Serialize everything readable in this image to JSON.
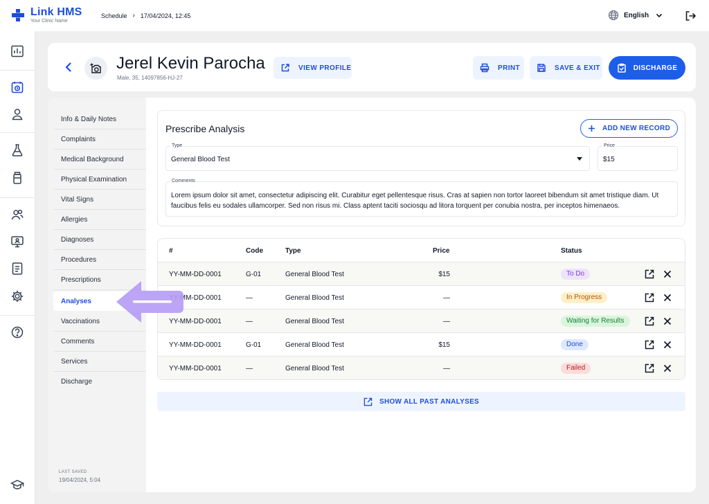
{
  "app": {
    "title": "Link HMS",
    "subtitle": "Your Clinic Name"
  },
  "breadcrumb": {
    "section": "Schedule",
    "separator": "›",
    "datetime": "17/04/2024, 12:45"
  },
  "language": "English",
  "patient": {
    "name": "Jerel Kevin Parocha",
    "meta": "Male, 35, 14097856-HJ-27"
  },
  "header_buttons": {
    "view_profile": "VIEW PROFILE",
    "print": "PRINT",
    "save_exit": "SAVE & EXIT",
    "discharge": "DISCHARGE"
  },
  "sidebar": {
    "items": [
      {
        "label": "Info & Daily Notes"
      },
      {
        "label": "Complaints"
      },
      {
        "label": "Medical Background"
      },
      {
        "label": "Physical Examination"
      },
      {
        "label": "Vital Signs"
      },
      {
        "label": "Allergies"
      },
      {
        "label": "Diagnoses"
      },
      {
        "label": "Procedures"
      },
      {
        "label": "Prescriptions"
      },
      {
        "label": "Analyses"
      },
      {
        "label": "Vaccinations"
      },
      {
        "label": "Comments"
      },
      {
        "label": "Services"
      },
      {
        "label": "Discharge"
      }
    ],
    "active": "Analyses",
    "last_saved_label": "LAST SAVED",
    "last_saved_value": "19/04/2024, 5:04"
  },
  "prescribe": {
    "title": "Prescribe Analysis",
    "add_button": "ADD NEW RECORD",
    "type_label": "Type",
    "type_value": "General Blood Test",
    "price_label": "Price",
    "price_value": "$15",
    "comments_label": "Comments",
    "comments_value": "Lorem ipsum dolor sit amet, consectetur adipiscing elit. Curabitur eget pellentesque risus. Cras at sapien non tortor laoreet bibendum sit amet tristique diam. Ut faucibus felis eu sodales ullamcorper. Sed non risus mi. Class aptent taciti sociosqu ad litora torquent per conubia nostra, per inceptos himenaeos."
  },
  "table": {
    "columns": {
      "id": "#",
      "code": "Code",
      "type": "Type",
      "price": "Price",
      "status": "Status"
    },
    "rows": [
      {
        "id": "YY-MM-DD-0001",
        "code": "G-01",
        "type": "General Blood Test",
        "price": "$15",
        "status": "To Do"
      },
      {
        "id": "YY-MM-DD-0001",
        "code": "—",
        "type": "General Blood Test",
        "price": "—",
        "status": "In Progress"
      },
      {
        "id": "YY-MM-DD-0001",
        "code": "—",
        "type": "General Blood Test",
        "price": "—",
        "status": "Waiting for Results"
      },
      {
        "id": "YY-MM-DD-0001",
        "code": "G-01",
        "type": "General Blood Test",
        "price": "$15",
        "status": "Done"
      },
      {
        "id": "YY-MM-DD-0001",
        "code": "—",
        "type": "General Blood Test",
        "price": "—",
        "status": "Failed"
      }
    ]
  },
  "status_colors": {
    "to_do": {
      "bg": "#ede4fb",
      "fg": "#7c3aed"
    },
    "in_progress": {
      "bg": "#fdf0c9",
      "fg": "#b45309"
    },
    "waiting": {
      "bg": "#daf5dc",
      "fg": "#15803d"
    },
    "done": {
      "bg": "#dde8fb",
      "fg": "#1d4ed8"
    },
    "failed": {
      "bg": "#fbdcdc",
      "fg": "#b91c1c"
    }
  },
  "show_all": "SHOW ALL PAST ANALYSES",
  "colors": {
    "accent": "#1d5ee8",
    "annotation": "#b69cf5"
  },
  "icons": {
    "rail": [
      "dashboard-icon",
      "calendar-icon",
      "user-icon",
      "flask-icon",
      "bottle-icon",
      "users-icon",
      "monitor-icon",
      "report-icon",
      "gear-icon",
      "help-icon",
      "graduation-cap-icon"
    ]
  }
}
